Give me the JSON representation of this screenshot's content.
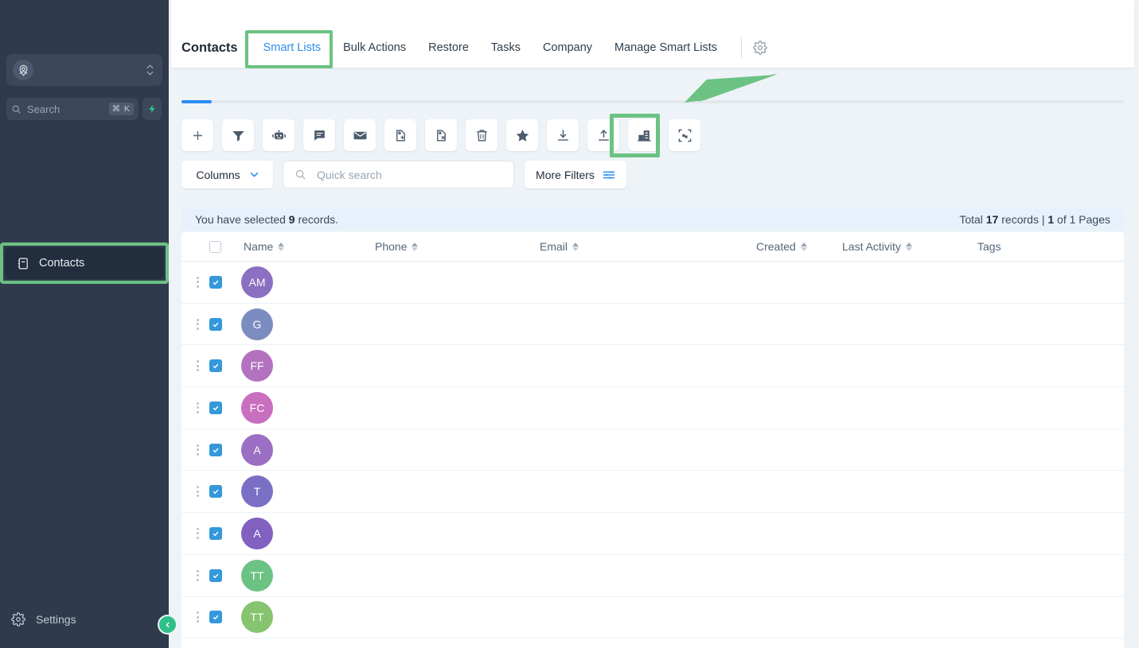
{
  "sidebar": {
    "location_switcher": {
      "icon": "location-pin-icon",
      "caret": "updown-caret-icon"
    },
    "search": {
      "placeholder": "Search",
      "shortcut": "⌘ K",
      "icon": "search-icon",
      "spark_icon": "lightning-bolt-icon"
    },
    "nav_items": [
      {
        "label": "Contacts",
        "icon": "contacts-book-icon",
        "active": true
      }
    ],
    "settings": {
      "label": "Settings",
      "icon": "gear-icon"
    },
    "collapse": {
      "icon": "chevron-left-icon"
    }
  },
  "header": {
    "title": "Contacts",
    "tabs": [
      {
        "label": "Smart Lists",
        "active": true
      },
      {
        "label": "Bulk Actions",
        "active": false
      },
      {
        "label": "Restore",
        "active": false
      },
      {
        "label": "Tasks",
        "active": false
      },
      {
        "label": "Company",
        "active": false
      },
      {
        "label": "Manage Smart Lists",
        "active": false
      }
    ],
    "gear_icon": "gear-icon"
  },
  "toolbar": {
    "buttons": [
      {
        "name": "add-contact-button",
        "icon": "plus-icon"
      },
      {
        "name": "filter-button",
        "icon": "funnel-icon"
      },
      {
        "name": "automation-button",
        "icon": "robot-icon"
      },
      {
        "name": "sms-button",
        "icon": "chat-bubble-icon"
      },
      {
        "name": "email-button",
        "icon": "envelope-icon"
      },
      {
        "name": "add-tag-button",
        "icon": "tag-plus-icon"
      },
      {
        "name": "remove-tag-button",
        "icon": "tag-remove-icon"
      },
      {
        "name": "delete-button",
        "icon": "trash-icon"
      },
      {
        "name": "favorite-button",
        "icon": "star-icon"
      },
      {
        "name": "import-button",
        "icon": "download-icon"
      },
      {
        "name": "export-button",
        "icon": "upload-icon"
      },
      {
        "name": "merge-company-button",
        "icon": "building-icon",
        "highlighted": true
      },
      {
        "name": "merge-contacts-button",
        "icon": "merge-frame-icon"
      }
    ]
  },
  "filters": {
    "columns_label": "Columns",
    "columns_caret": "chevron-down-icon",
    "quick_search_placeholder": "Quick search",
    "quick_search_value": "",
    "quick_search_icon": "search-icon",
    "more_filters_label": "More Filters",
    "more_filters_icon": "sliders-icon"
  },
  "selection_bar": {
    "left_prefix": "You have selected ",
    "selected_count": "9",
    "left_suffix": " records.",
    "right_prefix": "Total ",
    "total_count": "17",
    "right_mid": " records | ",
    "current_page": "1",
    "right_suffix": " of 1 Pages"
  },
  "table": {
    "columns": [
      {
        "label": "Name",
        "sortable": true
      },
      {
        "label": "Phone",
        "sortable": true
      },
      {
        "label": "Email",
        "sortable": true
      },
      {
        "label": "Created",
        "sortable": true
      },
      {
        "label": "Last Activity",
        "sortable": true
      },
      {
        "label": "Tags",
        "sortable": false
      }
    ],
    "header_checkbox_checked": false,
    "rows": [
      {
        "initials": "AM",
        "color": "#8b6fc0",
        "checked": true,
        "name": "",
        "phone": "",
        "email": "",
        "created": "",
        "last_activity": "",
        "tags": ""
      },
      {
        "initials": "G",
        "color": "#7b8dc0",
        "checked": true,
        "name": "",
        "phone": "",
        "email": "",
        "created": "",
        "last_activity": "",
        "tags": ""
      },
      {
        "initials": "FF",
        "color": "#b372bf",
        "checked": true,
        "name": "",
        "phone": "",
        "email": "",
        "created": "",
        "last_activity": "",
        "tags": ""
      },
      {
        "initials": "FC",
        "color": "#c86fc0",
        "checked": true,
        "name": "",
        "phone": "",
        "email": "",
        "created": "",
        "last_activity": "",
        "tags": ""
      },
      {
        "initials": "A",
        "color": "#9a6fc4",
        "checked": true,
        "name": "",
        "phone": "",
        "email": "",
        "created": "",
        "last_activity": "",
        "tags": ""
      },
      {
        "initials": "T",
        "color": "#7a6fc4",
        "checked": true,
        "name": "",
        "phone": "",
        "email": "",
        "created": "",
        "last_activity": "",
        "tags": ""
      },
      {
        "initials": "A",
        "color": "#8160c0",
        "checked": true,
        "name": "",
        "phone": "",
        "email": "",
        "created": "",
        "last_activity": "",
        "tags": ""
      },
      {
        "initials": "TT",
        "color": "#6cc283",
        "checked": true,
        "name": "",
        "phone": "",
        "email": "",
        "created": "",
        "last_activity": "",
        "tags": ""
      },
      {
        "initials": "TT",
        "color": "#86c46f",
        "checked": true,
        "name": "",
        "phone": "",
        "email": "",
        "created": "",
        "last_activity": "",
        "tags": ""
      }
    ]
  },
  "annotations": {
    "color": "#6cc283",
    "highlight_boxes": [
      "sidebar-contacts",
      "smart-lists-tab",
      "merge-company-button"
    ],
    "arrow": "points to merge-company-button"
  },
  "colors": {
    "sidebar_bg": "#2f3b4d",
    "accent_blue": "#2b8cf0",
    "annotation_green": "#6cc283",
    "page_bg": "#eef3f8"
  }
}
